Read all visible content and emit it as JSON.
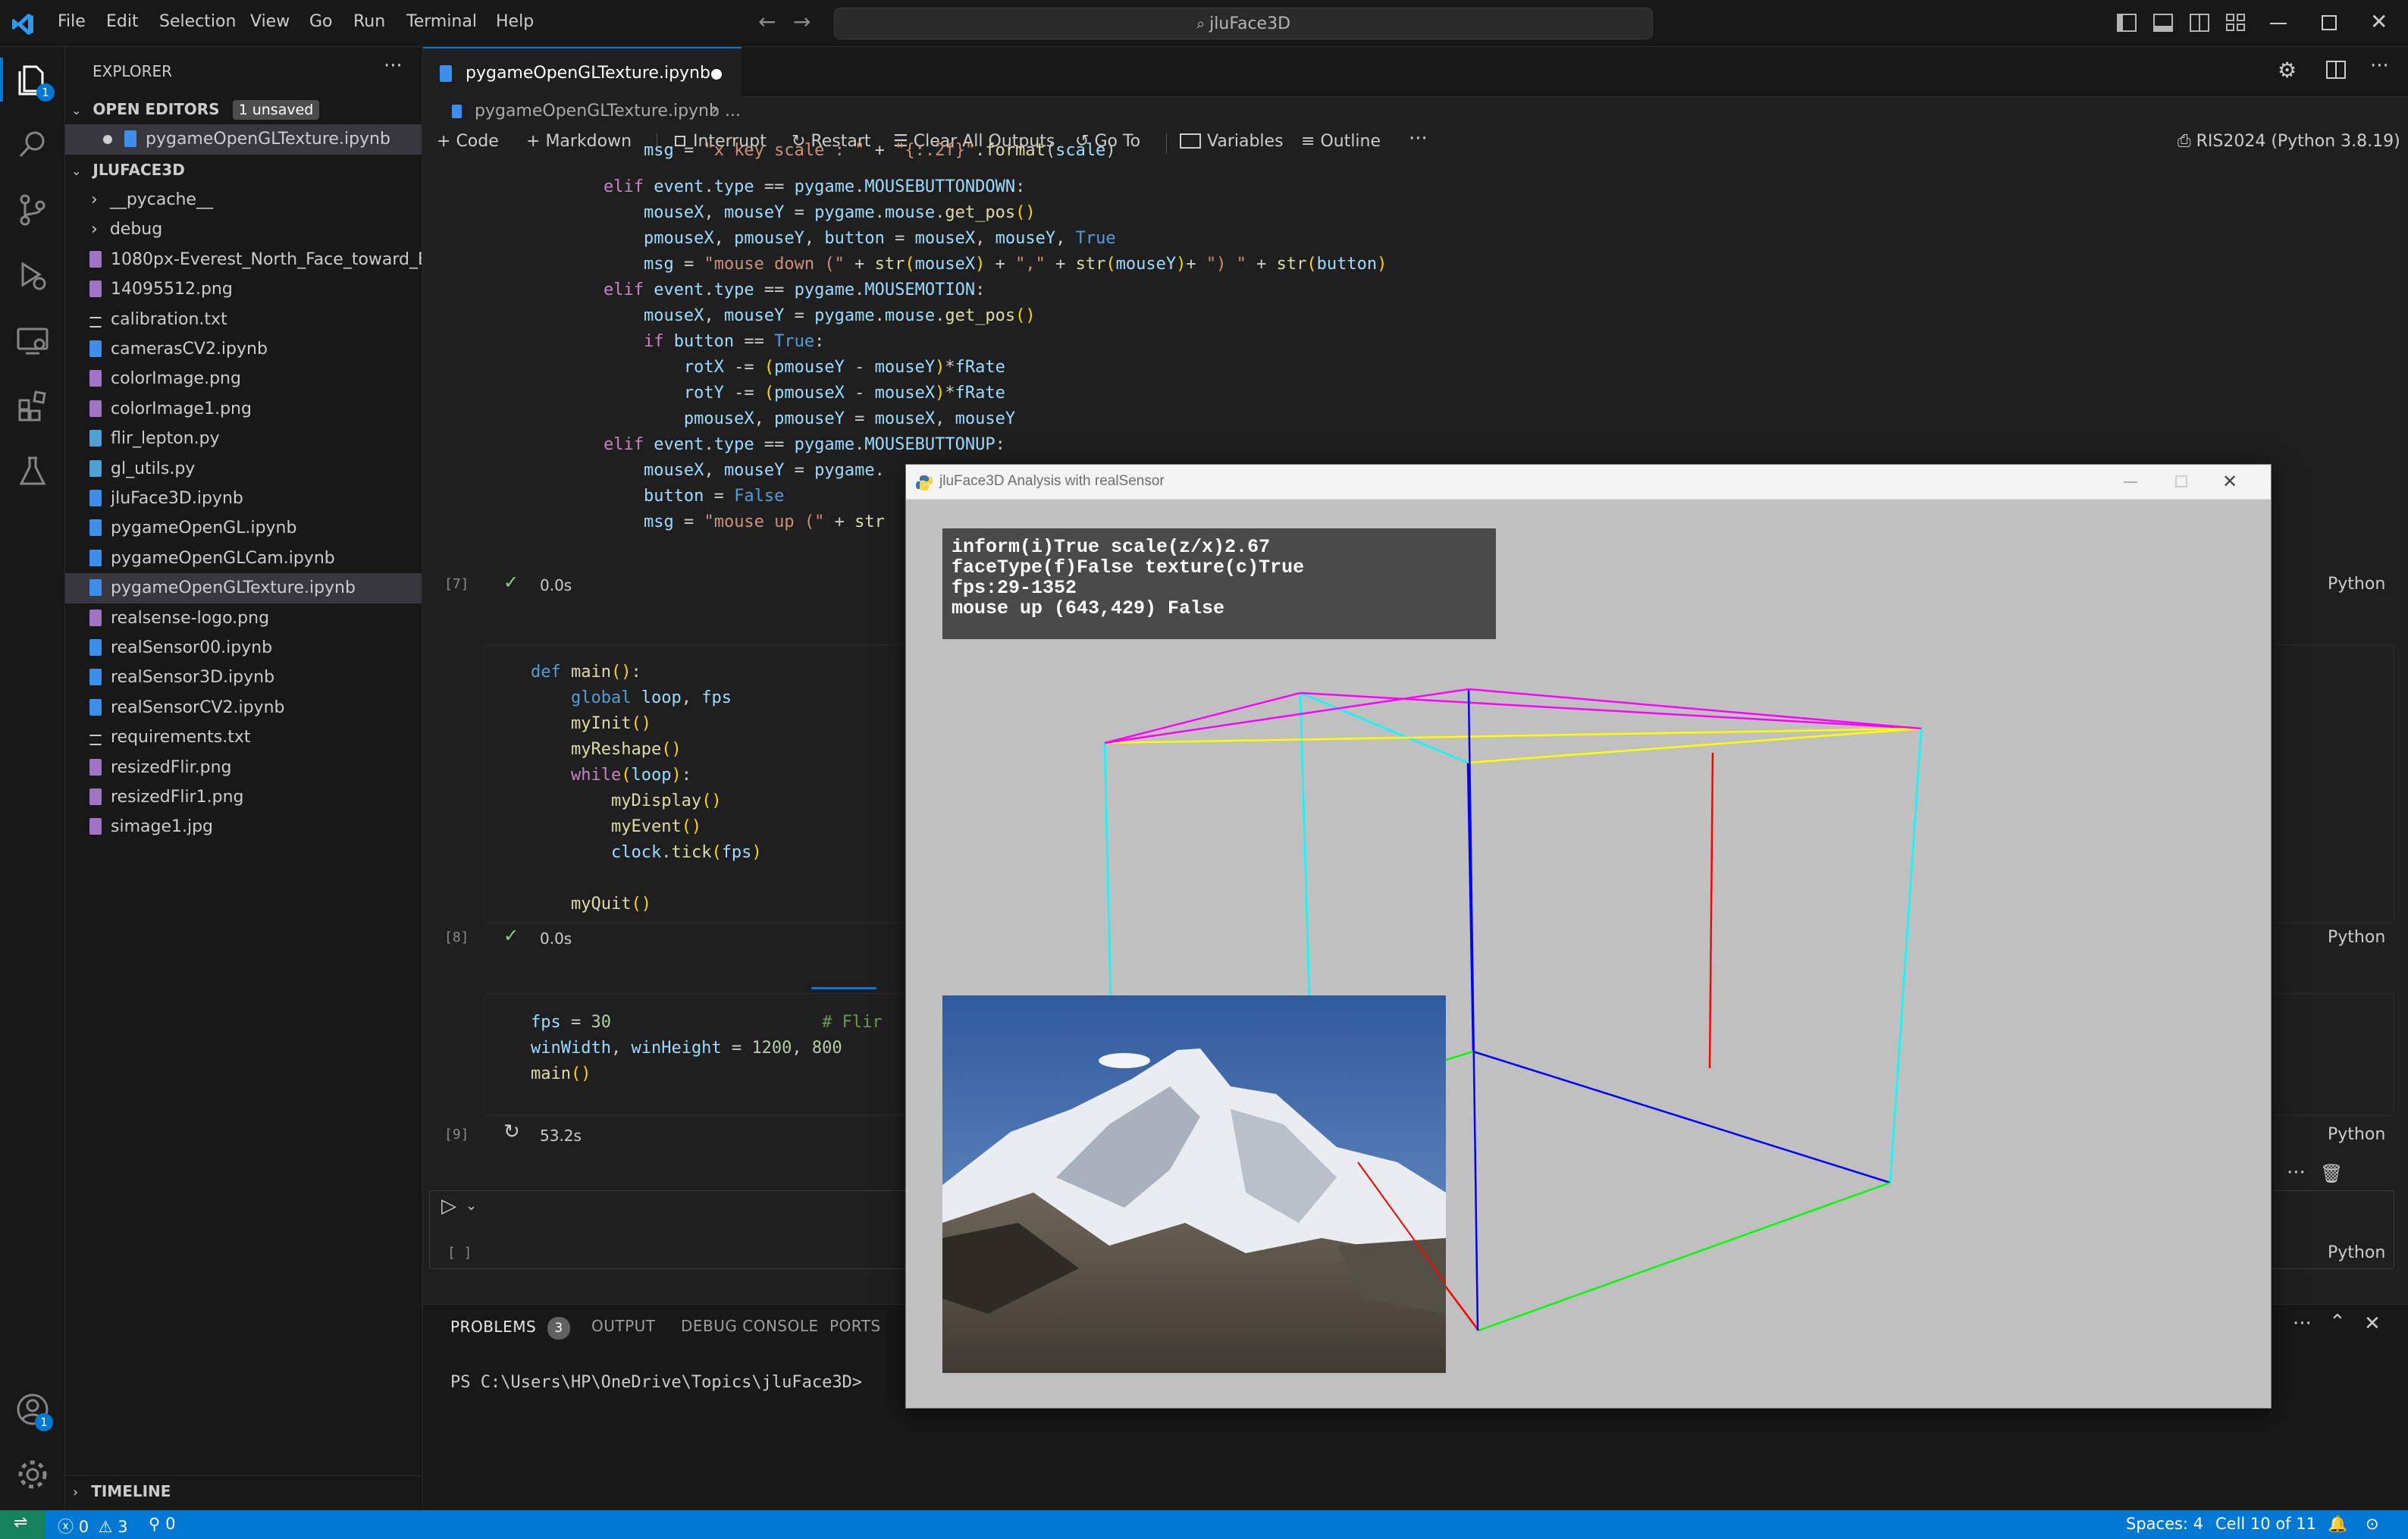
{
  "titlebar": {
    "menus": [
      "File",
      "Edit",
      "Selection",
      "View",
      "Go",
      "Run",
      "Terminal",
      "Help"
    ],
    "search_text": "jluFace3D"
  },
  "activity": {
    "explorer_badge": "1",
    "account_badge": "1"
  },
  "sidebar": {
    "title": "EXPLORER",
    "open_editors_label": "OPEN EDITORS",
    "unsaved_badge": "1 unsaved",
    "open_file": "pygameOpenGLTexture.ipynb",
    "folder_label": "JLUFACE3D",
    "items": [
      {
        "label": "__pycache__",
        "kind": "folder"
      },
      {
        "label": "debug",
        "kind": "folder"
      },
      {
        "label": "1080px-Everest_North_Face_toward_B...",
        "kind": "image"
      },
      {
        "label": "14095512.png",
        "kind": "image"
      },
      {
        "label": "calibration.txt",
        "kind": "text"
      },
      {
        "label": "camerasCV2.ipynb",
        "kind": "notebook"
      },
      {
        "label": "colorImage.png",
        "kind": "image"
      },
      {
        "label": "colorImage1.png",
        "kind": "image"
      },
      {
        "label": "flir_lepton.py",
        "kind": "python"
      },
      {
        "label": "gl_utils.py",
        "kind": "python"
      },
      {
        "label": "jluFace3D.ipynb",
        "kind": "notebook"
      },
      {
        "label": "pygameOpenGL.ipynb",
        "kind": "notebook"
      },
      {
        "label": "pygameOpenGLCam.ipynb",
        "kind": "notebook"
      },
      {
        "label": "pygameOpenGLTexture.ipynb",
        "kind": "notebook"
      },
      {
        "label": "realsense-logo.png",
        "kind": "image"
      },
      {
        "label": "realSensor00.ipynb",
        "kind": "notebook"
      },
      {
        "label": "realSensor3D.ipynb",
        "kind": "notebook"
      },
      {
        "label": "realSensorCV2.ipynb",
        "kind": "notebook"
      },
      {
        "label": "requirements.txt",
        "kind": "text"
      },
      {
        "label": "resizedFlir.png",
        "kind": "image"
      },
      {
        "label": "resizedFlir1.png",
        "kind": "image"
      },
      {
        "label": "simage1.jpg",
        "kind": "image"
      }
    ],
    "timeline_label": "TIMELINE"
  },
  "editor": {
    "tab_label": "pygameOpenGLTexture.ipynb",
    "breadcrumb_file": "pygameOpenGLTexture.ipynb",
    "breadcrumb_more": "...",
    "toolbar": {
      "code": "Code",
      "markdown": "Markdown",
      "interrupt": "Interrupt",
      "restart": "Restart",
      "clear": "Clear All Outputs",
      "goto": "Go To",
      "variables": "Variables",
      "outline": "Outline",
      "more": "···",
      "kernel": "RIS2024 (Python 3.8.19)"
    },
    "cells": [
      {
        "exec": "[7]",
        "time": "0.0s",
        "lang": "Python"
      },
      {
        "exec": "[8]",
        "time": "0.0s",
        "lang": "Python"
      },
      {
        "exec": "[9]",
        "time": "53.2s",
        "lang": "Python"
      },
      {
        "exec": "[ ]",
        "lang": "Python"
      }
    ]
  },
  "panel": {
    "problems": "PROBLEMS",
    "problems_count": "3",
    "output": "OUTPUT",
    "debug_console": "DEBUG CONSOLE",
    "ports": "PORTS",
    "prompt": "PS C:\\Users\\HP\\OneDrive\\Topics\\jluFace3D>"
  },
  "statusbar": {
    "errors": "0",
    "warnings": "3",
    "ports": "0",
    "spaces": "Spaces: 4",
    "cell": "Cell 10 of 11"
  },
  "pygame": {
    "title": "jluFace3D Analysis with realSensor",
    "hud": [
      "inform(i)True scale(z/x)2.67",
      "faceType(f)False texture(c)True",
      "fps:29-1352",
      "mouse up (643,429) False"
    ]
  },
  "colors": {
    "accent": "#0078d4",
    "edge_magenta": "#ff00ff",
    "edge_yellow": "#ffff00",
    "edge_cyan": "#00ffff",
    "edge_blue": "#0000ff",
    "edge_red": "#ff0000",
    "edge_green": "#00ff00"
  }
}
